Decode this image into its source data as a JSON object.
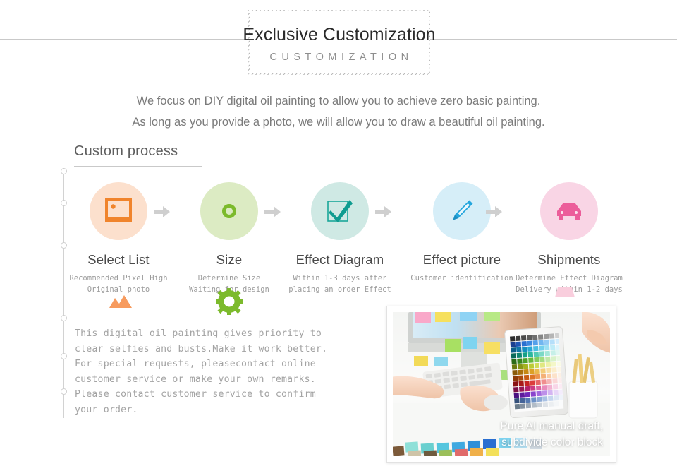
{
  "header": {
    "title_main": "Exclusive Customization",
    "title_sub": "CUSTOMIZATION"
  },
  "intro": {
    "line1": "We focus on DIY digital oil painting to allow you to achieve zero basic painting.",
    "line2": "As long as you provide a photo, we will allow you to draw a beautiful oil painting."
  },
  "section": {
    "heading": "Custom process"
  },
  "process": {
    "arrow_icon": "arrow-right-icon",
    "steps": [
      {
        "icon": "image-photo-icon",
        "title": "Select List",
        "desc_line1": "Recommended Pixel High",
        "desc_line2": "Original photo",
        "circle_color": "#fce0cd",
        "icon_color": "#f0842c"
      },
      {
        "icon": "ring-circle-icon",
        "title": "Size",
        "desc_line1": "Determine Size",
        "desc_line2": "Waiting for design",
        "circle_color": "#dcebc3",
        "icon_color": "#7cba2c"
      },
      {
        "icon": "checkbox-check-icon",
        "title": "Effect Diagram",
        "desc_line1": "Within 1-3 days after",
        "desc_line2": "placing an order Effect",
        "circle_color": "#cfe9e4",
        "icon_color": "#1aa79a"
      },
      {
        "icon": "pen-pencil-icon",
        "title": "Effect picture",
        "desc_line1": "Customer identification",
        "desc_line2": "",
        "circle_color": "#d6eef8",
        "icon_color": "#24a6dd"
      },
      {
        "icon": "car-delivery-icon",
        "title": "Shipments",
        "desc_line1": "Determine Effect Diagram",
        "desc_line2": "Delivery within 1-2 days",
        "circle_color": "#f9d5e5",
        "icon_color": "#ec5d9a"
      }
    ]
  },
  "decor": {
    "mountain_icon": "mountain-peaks-icon",
    "mountain_color": "#f79b5e",
    "gear_icon": "gear-icon",
    "gear_color": "#7cba2c",
    "trapezoid_icon": "trapezoid-shape-icon",
    "trapezoid_color": "#f9cedd"
  },
  "body_copy": {
    "line1": "This digital oil painting gives priority to",
    "line2": "clear selfies and busts.Make it work better.",
    "line3": "For special requests, pleasecontact online",
    "line4": "customer service or make your own remarks.",
    "line5": "Please contact customer service to confirm",
    "line6": "your order."
  },
  "photo": {
    "alt_name": "designer-desk-photo",
    "caption_line1": "Pure AI manual draft,",
    "caption_line2": "subdivide color block"
  }
}
